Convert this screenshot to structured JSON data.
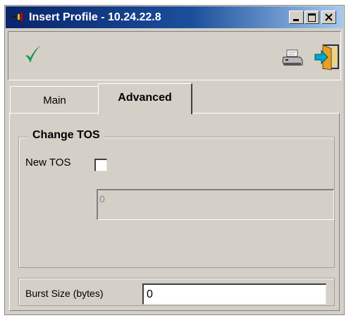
{
  "window": {
    "title": "Insert Profile - 10.24.22.8"
  },
  "toolbar": {
    "icons": [
      "check-icon",
      "printer-icon",
      "exit-icon"
    ],
    "colors": {
      "check": "#1a9a4a",
      "exit_arrow": "#00a9c8"
    }
  },
  "tabs": [
    {
      "label": "Main",
      "selected": false
    },
    {
      "label": "Advanced",
      "selected": true
    }
  ],
  "change_tos": {
    "legend": "Change TOS",
    "new_tos_label": "New TOS",
    "new_tos_checked": false,
    "value": "0"
  },
  "burst": {
    "label": "Burst Size (bytes)",
    "value": "0"
  },
  "colors": {
    "title_bar": "#0a246a",
    "face": "#d4d0c8"
  }
}
